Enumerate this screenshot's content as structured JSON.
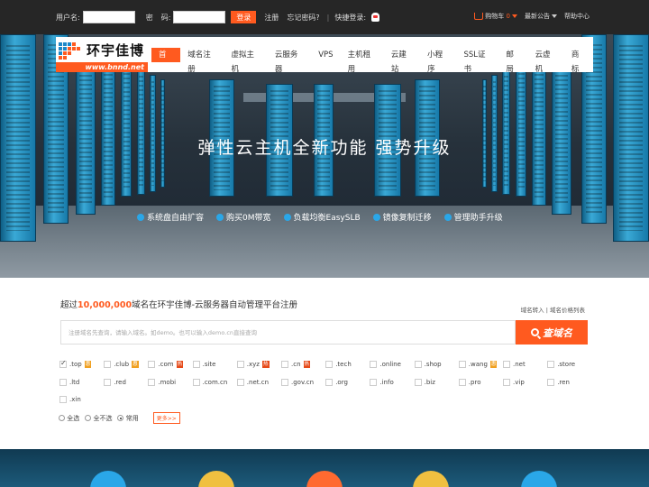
{
  "topbar": {
    "username_label": "用户名:",
    "password_label": "密",
    "password_label2": "码:",
    "login_button": "登录",
    "register_link": "注册",
    "forgot_link": "忘记密码?",
    "separator": "|",
    "quick_login": "快捷登录:",
    "cart_label": "购物车",
    "cart_count": "0",
    "notice_label": "最新公告",
    "help_label": "帮助中心"
  },
  "logo": {
    "name": "环宇佳博",
    "url": "www.bnnd.net"
  },
  "nav": {
    "items": [
      "首页",
      "域名注册",
      "虚拟主机",
      "云服务器",
      "VPS",
      "主机租用",
      "云建站",
      "小程序",
      "SSL证书",
      "邮局",
      "云虚机",
      "商标"
    ],
    "active_index": 0
  },
  "banner": {
    "title": "弹性云主机全新功能  强势升级",
    "features": [
      "系统盘自由扩容",
      "购买0M带宽",
      "负载均衡EasySLB",
      "镜像复制迁移",
      "管理助手升级"
    ]
  },
  "domain_search": {
    "head_prefix": "超过",
    "head_number": "10,000,000",
    "head_suffix": "域名在环宇佳博-云服务器自动管理平台注册",
    "links": "域名转入  |  域名价格列表",
    "placeholder": "注册域名先查询，请输入域名。如demo。也可以输入demo.cn直接查询",
    "button": "查域名"
  },
  "tlds": [
    {
      "name": ".top",
      "checked": true,
      "badge": "惠",
      "badge_type": "sale"
    },
    {
      "name": ".club",
      "checked": false,
      "badge": "惠",
      "badge_type": "sale"
    },
    {
      "name": ".com",
      "checked": false,
      "badge": "热",
      "badge_type": "hot"
    },
    {
      "name": ".site",
      "checked": false,
      "badge": "",
      "badge_type": ""
    },
    {
      "name": ".xyz",
      "checked": false,
      "badge": "热",
      "badge_type": "hot"
    },
    {
      "name": ".cn",
      "checked": false,
      "badge": "热",
      "badge_type": "hot"
    },
    {
      "name": ".tech",
      "checked": false,
      "badge": "",
      "badge_type": ""
    },
    {
      "name": ".online",
      "checked": false,
      "badge": "",
      "badge_type": ""
    },
    {
      "name": ".shop",
      "checked": false,
      "badge": "",
      "badge_type": ""
    },
    {
      "name": ".wang",
      "checked": false,
      "badge": "惠",
      "badge_type": "sale"
    },
    {
      "name": ".net",
      "checked": false,
      "badge": "",
      "badge_type": ""
    },
    {
      "name": ".store",
      "checked": false,
      "badge": "",
      "badge_type": ""
    },
    {
      "name": ".ltd",
      "checked": false,
      "badge": "",
      "badge_type": ""
    },
    {
      "name": ".red",
      "checked": false,
      "badge": "",
      "badge_type": ""
    },
    {
      "name": ".mobi",
      "checked": false,
      "badge": "",
      "badge_type": ""
    },
    {
      "name": ".com.cn",
      "checked": false,
      "badge": "",
      "badge_type": ""
    },
    {
      "name": ".net.cn",
      "checked": false,
      "badge": "",
      "badge_type": ""
    },
    {
      "name": ".gov.cn",
      "checked": false,
      "badge": "",
      "badge_type": ""
    },
    {
      "name": ".org",
      "checked": false,
      "badge": "",
      "badge_type": ""
    },
    {
      "name": ".info",
      "checked": false,
      "badge": "",
      "badge_type": ""
    },
    {
      "name": ".biz",
      "checked": false,
      "badge": "",
      "badge_type": ""
    },
    {
      "name": ".pro",
      "checked": false,
      "badge": "",
      "badge_type": ""
    },
    {
      "name": ".vip",
      "checked": false,
      "badge": "",
      "badge_type": ""
    },
    {
      "name": ".ren",
      "checked": false,
      "badge": "",
      "badge_type": ""
    },
    {
      "name": ".xin",
      "checked": false,
      "badge": "",
      "badge_type": ""
    }
  ],
  "select_options": {
    "all": "全选",
    "none": "全不选",
    "common": "常用",
    "selected": "common",
    "more": "更多>>"
  },
  "colors": {
    "accent": "#ff5a1f",
    "topbar": "#262626",
    "feature_dot": "#2aa7e8"
  }
}
